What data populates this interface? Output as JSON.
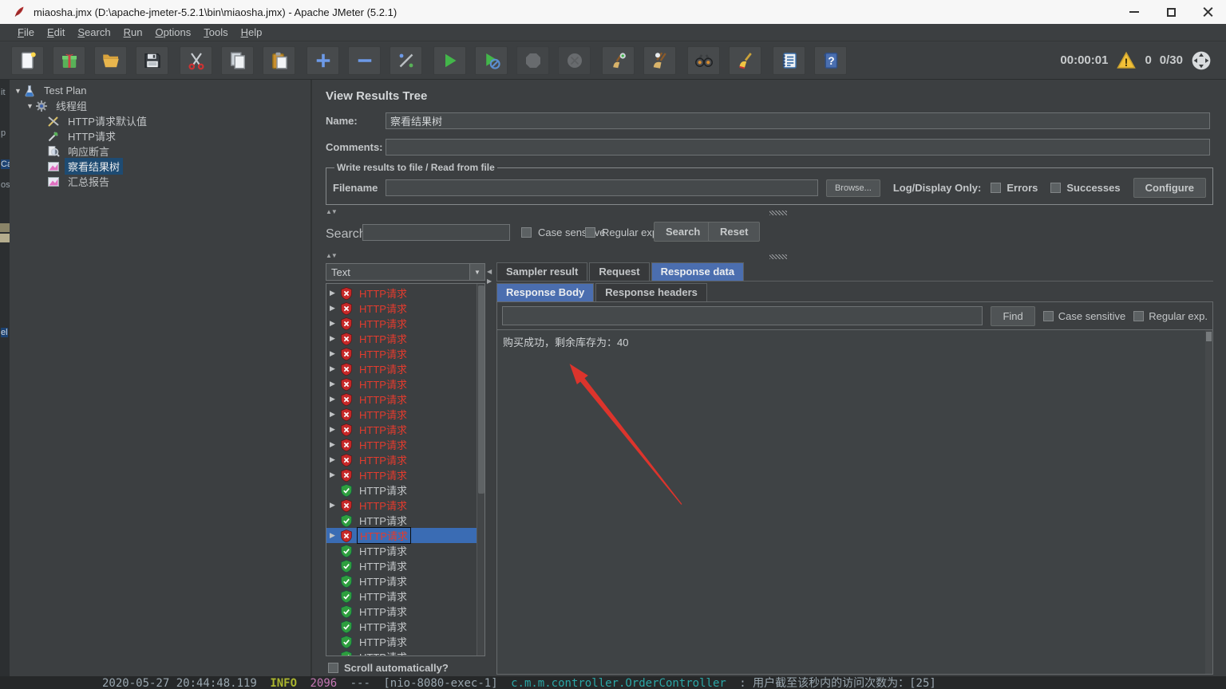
{
  "window": {
    "title": "miaosha.jmx (D:\\apache-jmeter-5.2.1\\bin\\miaosha.jmx) - Apache JMeter (5.2.1)"
  },
  "menu": {
    "items": [
      "File",
      "Edit",
      "Search",
      "Run",
      "Options",
      "Tools",
      "Help"
    ]
  },
  "toolbar": {
    "groups": [
      [
        "new",
        "templates",
        "open",
        "save"
      ],
      [
        "cut",
        "copy",
        "paste"
      ],
      [
        "expand-all",
        "collapse-all",
        "toggle"
      ],
      [
        "start",
        "start-no-timers",
        "stop",
        "shutdown"
      ],
      [
        "clear",
        "clear-all"
      ],
      [
        "search",
        "search-reset"
      ],
      [
        "function-helper",
        "help"
      ]
    ],
    "disabled": [
      "stop",
      "shutdown"
    ],
    "timer": "00:00:01",
    "warning_count": "0",
    "thread_count": "0/30"
  },
  "sidebar": {
    "items": [
      {
        "label": "Test Plan",
        "icon": "test-plan-flask-icon",
        "level": 0,
        "expander": "open"
      },
      {
        "label": "线程组",
        "icon": "thread-group-gear-icon",
        "level": 1,
        "expander": "open"
      },
      {
        "label": "HTTP请求默认值",
        "icon": "http-defaults-wrench-icon",
        "level": 2,
        "expander": "none"
      },
      {
        "label": "HTTP请求",
        "icon": "http-sampler-dropper-icon",
        "level": 2,
        "expander": "none"
      },
      {
        "label": "响应断言",
        "icon": "assertion-magnifier-icon",
        "level": 2,
        "expander": "none"
      },
      {
        "label": "察看结果树",
        "icon": "results-chart-icon",
        "level": 2,
        "expander": "none",
        "selected": true
      },
      {
        "label": "汇总报告",
        "icon": "results-chart-icon",
        "level": 2,
        "expander": "none"
      }
    ]
  },
  "main": {
    "title": "View Results Tree",
    "name_label": "Name:",
    "name_value": "察看结果树",
    "comments_label": "Comments:",
    "comments_value": "",
    "file_group": {
      "legend": "Write results to file / Read from file",
      "filename_label": "Filename",
      "filename_value": "",
      "browse_label": "Browse...",
      "log_display_label": "Log/Display Only:",
      "errors_label": "Errors",
      "successes_label": "Successes",
      "configure_label": "Configure"
    },
    "search_bar": {
      "label": "Search:",
      "value": "",
      "case_label": "Case sensitive",
      "regex_label": "Regular exp.",
      "search_label": "Search",
      "reset_label": "Reset"
    }
  },
  "results": {
    "format_value": "Text",
    "scroll_label": "Scroll automatically?",
    "items": [
      {
        "label": "HTTP请求",
        "status": "error",
        "expandable": true
      },
      {
        "label": "HTTP请求",
        "status": "error",
        "expandable": true
      },
      {
        "label": "HTTP请求",
        "status": "error",
        "expandable": true
      },
      {
        "label": "HTTP请求",
        "status": "error",
        "expandable": true
      },
      {
        "label": "HTTP请求",
        "status": "error",
        "expandable": true
      },
      {
        "label": "HTTP请求",
        "status": "error",
        "expandable": true
      },
      {
        "label": "HTTP请求",
        "status": "error",
        "expandable": true
      },
      {
        "label": "HTTP请求",
        "status": "error",
        "expandable": true
      },
      {
        "label": "HTTP请求",
        "status": "error",
        "expandable": true
      },
      {
        "label": "HTTP请求",
        "status": "error",
        "expandable": true
      },
      {
        "label": "HTTP请求",
        "status": "error",
        "expandable": true
      },
      {
        "label": "HTTP请求",
        "status": "error",
        "expandable": true
      },
      {
        "label": "HTTP请求",
        "status": "error",
        "expandable": true
      },
      {
        "label": "HTTP请求",
        "status": "success",
        "expandable": false
      },
      {
        "label": "HTTP请求",
        "status": "error",
        "expandable": true
      },
      {
        "label": "HTTP请求",
        "status": "success",
        "expandable": false
      },
      {
        "label": "HTTP请求",
        "status": "error",
        "expandable": true,
        "selected": true
      },
      {
        "label": "HTTP请求",
        "status": "success",
        "expandable": false
      },
      {
        "label": "HTTP请求",
        "status": "success",
        "expandable": false
      },
      {
        "label": "HTTP请求",
        "status": "success",
        "expandable": false
      },
      {
        "label": "HTTP请求",
        "status": "success",
        "expandable": false
      },
      {
        "label": "HTTP请求",
        "status": "success",
        "expandable": false
      },
      {
        "label": "HTTP请求",
        "status": "success",
        "expandable": false
      },
      {
        "label": "HTTP请求",
        "status": "success",
        "expandable": false
      },
      {
        "label": "HTTP请求",
        "status": "success",
        "expandable": false
      }
    ]
  },
  "viewer": {
    "tabs": [
      "Sampler result",
      "Request",
      "Response data"
    ],
    "active_tab": "Response data",
    "subtabs": [
      "Response Body",
      "Response headers"
    ],
    "active_subtab": "Response Body",
    "find": {
      "value": "",
      "find_label": "Find",
      "case_label": "Case sensitive",
      "regex_label": "Regular exp."
    },
    "body_text": "购买成功，剩余库存为：40"
  },
  "statusbar": {
    "timestamp": "2020-05-27 20:44:48.119",
    "level": "INFO",
    "pid": "2096",
    "separator": "---",
    "thread": "[nio-8080-exec-1]",
    "logger": "c.m.m.controller.OrderController",
    "message": ": 用户截至该秒内的访问次数为：[25]"
  },
  "background_fragments": {
    "f0": "it",
    "f1": "p",
    "f2": "Ca",
    "f3": "os",
    "f4": "el"
  },
  "colors": {
    "accent_blue": "#4b6eaf",
    "selection_blue": "#3a6cb4",
    "error_red": "#e23b2e",
    "success_green": "#3fae4a",
    "warning_yellow": "#f2c037",
    "arrow_red": "#e5342b"
  }
}
